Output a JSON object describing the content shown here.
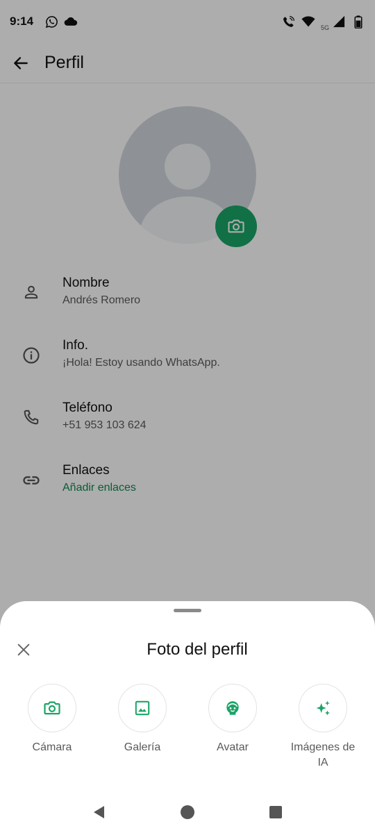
{
  "status_bar": {
    "time": "9:14",
    "network_label": "5G",
    "left_icons": [
      "whatsapp-icon",
      "cloud-icon"
    ],
    "right_icons": [
      "wifi-calling-icon",
      "wifi-icon",
      "signal-icon",
      "battery-icon"
    ]
  },
  "app_bar": {
    "title": "Perfil",
    "back_icon": "arrow-left-icon"
  },
  "profile": {
    "avatar_icon": "default-avatar",
    "camera_icon": "camera-icon",
    "fields": [
      {
        "icon": "person-icon",
        "label": "Nombre",
        "value": "Andrés Romero"
      },
      {
        "icon": "info-icon",
        "label": "Info.",
        "value": "¡Hola! Estoy usando WhatsApp."
      },
      {
        "icon": "phone-icon",
        "label": "Teléfono",
        "value": "+51 953 103 624"
      },
      {
        "icon": "link-icon",
        "label": "Enlaces",
        "value": "Añadir enlaces"
      }
    ]
  },
  "sheet": {
    "title": "Foto del perfil",
    "close_icon": "close-icon",
    "options": [
      {
        "icon": "camera-icon",
        "label": "Cámara"
      },
      {
        "icon": "gallery-icon",
        "label": "Galería"
      },
      {
        "icon": "avatar-icon",
        "label": "Avatar"
      },
      {
        "icon": "ai-sparkle-icon",
        "label": "Imágenes de IA"
      }
    ]
  },
  "nav_bar": {
    "buttons": [
      "back-triangle-icon",
      "home-circle-icon",
      "recents-square-icon"
    ]
  },
  "colors": {
    "accent": "#1aa567",
    "link": "#0f8a4f",
    "scrim": "rgba(0,0,0,0.32)",
    "avatar_bg": "#d1d8dd"
  }
}
